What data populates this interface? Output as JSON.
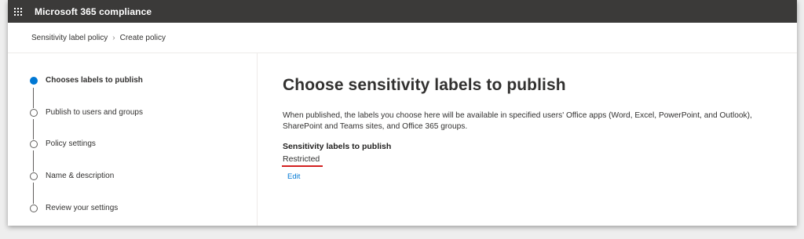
{
  "app": {
    "title": "Microsoft 365 compliance"
  },
  "breadcrumb": {
    "parent": "Sensitivity label policy",
    "current": "Create policy"
  },
  "steps": [
    {
      "label": "Chooses labels to publish",
      "active": true
    },
    {
      "label": "Publish to users and groups",
      "active": false
    },
    {
      "label": "Policy settings",
      "active": false
    },
    {
      "label": "Name & description",
      "active": false
    },
    {
      "label": "Review your settings",
      "active": false
    }
  ],
  "main": {
    "heading": "Choose sensitivity labels to publish",
    "description": "When published, the labels you choose here will be available in specified users' Office apps (Word, Excel, PowerPoint, and Outlook), SharePoint and Teams sites, and Office 365 groups.",
    "section_label": "Sensitivity labels to publish",
    "selected_label": "Restricted",
    "edit_link": "Edit"
  },
  "colors": {
    "topbar": "#3b3a39",
    "accent": "#0078d4",
    "annotation": "#d32020"
  }
}
